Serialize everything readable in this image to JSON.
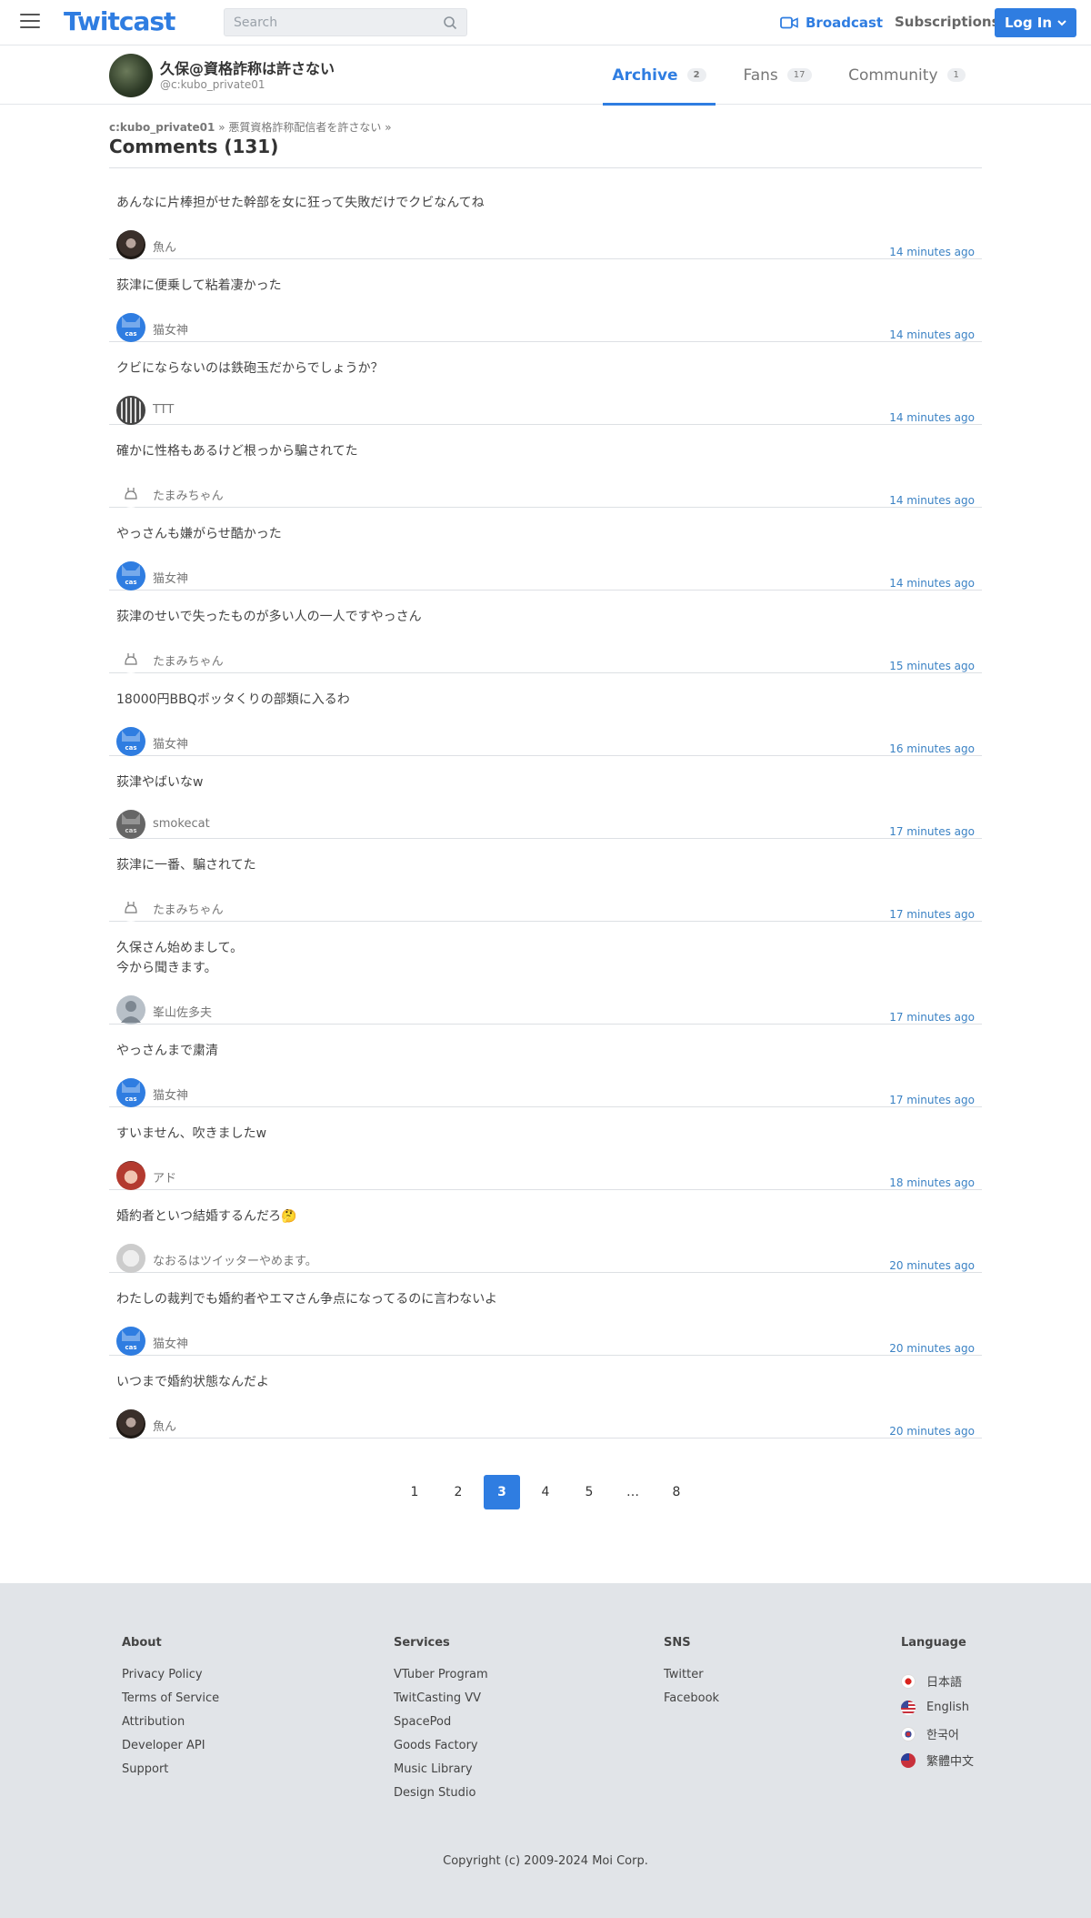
{
  "header": {
    "logo": "Twitcast",
    "search_placeholder": "Search",
    "broadcast": "Broadcast",
    "subscriptions": "Subscriptions",
    "login": "Log In"
  },
  "profile": {
    "name": "久保@資格詐称は許さない",
    "handle": "@c:kubo_private01",
    "tabs": [
      {
        "label": "Archive",
        "count": "2"
      },
      {
        "label": "Fans",
        "count": "17"
      },
      {
        "label": "Community",
        "count": "1"
      }
    ]
  },
  "breadcrumb": {
    "user": "c:kubo_private01",
    "separator1": "»",
    "movie": "悪質資格詐称配信者を許さない",
    "separator2": "»"
  },
  "page_title": "Comments (131)",
  "comments": [
    {
      "text": "あんなに片棒担がせた幹部を女に狂って失敗だけでクビなんてね",
      "user": "魚ん",
      "time": "14 minutes ago",
      "avatar": "fish"
    },
    {
      "text": "荻津に便乗して粘着凄かった",
      "user": "猫女神",
      "time": "14 minutes ago",
      "avatar": "cat"
    },
    {
      "text": "クビにならないのは鉄砲玉だからでしょうか？",
      "user": "TTT",
      "time": "14 minutes ago",
      "avatar": "ttt"
    },
    {
      "text": "確かに性格もあるけど根っから騙されてた",
      "user": "たまみちゃん",
      "time": "14 minutes ago",
      "avatar": "tama"
    },
    {
      "text": "やっさんも嫌がらせ酷かった",
      "user": "猫女神",
      "time": "14 minutes ago",
      "avatar": "cat"
    },
    {
      "text": "荻津のせいで失ったものが多い人の一人ですやっさん",
      "user": "たまみちゃん",
      "time": "15 minutes ago",
      "avatar": "tama"
    },
    {
      "text": "18000円BBQボッタくりの部類に入るわ",
      "user": "猫女神",
      "time": "16 minutes ago",
      "avatar": "cat"
    },
    {
      "text": "荻津やばいなw",
      "user": "smokecat",
      "time": "17 minutes ago",
      "avatar": "smoke"
    },
    {
      "text": "荻津に一番、騙されてた",
      "user": "たまみちゃん",
      "time": "17 minutes ago",
      "avatar": "tama"
    },
    {
      "text": "久保さん始めまして。\n今から聞きます。",
      "user": "峯山佐多夫",
      "time": "17 minutes ago",
      "avatar": "person"
    },
    {
      "text": "やっさんまで粛清",
      "user": "猫女神",
      "time": "17 minutes ago",
      "avatar": "cat"
    },
    {
      "text": "すいません、吹きましたw",
      "user": "アド",
      "time": "18 minutes ago",
      "avatar": "ado"
    },
    {
      "text": "婚約者といつ結婚するんだろ🤔",
      "user": "なおるはツイッターやめます。",
      "time": "20 minutes ago",
      "avatar": "nao"
    },
    {
      "text": "わたしの裁判でも婚約者やエマさん争点になってるのに言わないよ",
      "user": "猫女神",
      "time": "20 minutes ago",
      "avatar": "cat"
    },
    {
      "text": "いつまで婚約状態なんだよ",
      "user": "魚ん",
      "time": "20 minutes ago",
      "avatar": "fish"
    }
  ],
  "pagination": [
    "1",
    "2",
    "3",
    "4",
    "5",
    "…",
    "8"
  ],
  "pagination_active": "3",
  "footer": {
    "about": {
      "title": "About",
      "links": [
        "Privacy Policy",
        "Terms of Service",
        "Attribution",
        "Developer API",
        "Support"
      ]
    },
    "services": {
      "title": "Services",
      "links": [
        "VTuber Program",
        "TwitCasting VV",
        "SpacePod",
        "Goods Factory",
        "Music Library",
        "Design Studio"
      ]
    },
    "sns": {
      "title": "SNS",
      "links": [
        "Twitter",
        "Facebook"
      ]
    },
    "language": {
      "title": "Language",
      "items": [
        {
          "label": "日本語",
          "flag": "jp"
        },
        {
          "label": "English",
          "flag": "us"
        },
        {
          "label": "한국어",
          "flag": "kr"
        },
        {
          "label": "繁體中文",
          "flag": "tw"
        }
      ]
    },
    "copyright": "Copyright (c) 2009-2024 Moi Corp."
  },
  "colors": {
    "accent": "#2f7de1",
    "time": "#3b82c4",
    "footer_bg": "#e1e4e8"
  }
}
